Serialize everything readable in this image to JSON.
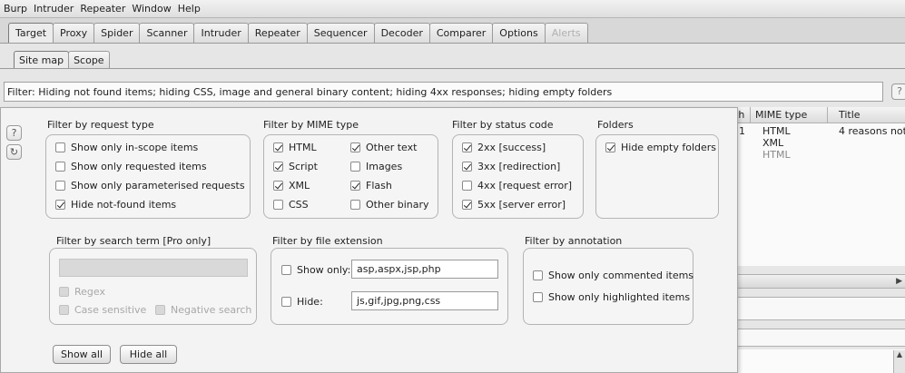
{
  "menubar": [
    "Burp",
    "Intruder",
    "Repeater",
    "Window",
    "Help"
  ],
  "main_tabs": [
    {
      "label": "Target",
      "active": true
    },
    {
      "label": "Proxy"
    },
    {
      "label": "Spider"
    },
    {
      "label": "Scanner"
    },
    {
      "label": "Intruder"
    },
    {
      "label": "Repeater"
    },
    {
      "label": "Sequencer"
    },
    {
      "label": "Decoder"
    },
    {
      "label": "Comparer"
    },
    {
      "label": "Options"
    },
    {
      "label": "Alerts",
      "disabled": true
    }
  ],
  "sub_tabs": [
    {
      "label": "Site map",
      "active": true
    },
    {
      "label": "Scope"
    }
  ],
  "filter_bar": {
    "text": "Filter: Hiding not found items;  hiding CSS, image and general binary content;  hiding 4xx responses;  hiding empty folders",
    "help_label": "?"
  },
  "popup": {
    "help_icon": "?",
    "refresh_icon": "↻",
    "request_type": {
      "title": "Filter by request type",
      "options": [
        {
          "label": "Show only in-scope items",
          "checked": false
        },
        {
          "label": "Show only requested items",
          "checked": false
        },
        {
          "label": "Show only parameterised requests",
          "checked": false
        },
        {
          "label": "Hide not-found items",
          "checked": true
        }
      ]
    },
    "mime_type": {
      "title": "Filter by MIME type",
      "options": [
        {
          "label": "HTML",
          "checked": true
        },
        {
          "label": "Other text",
          "checked": true
        },
        {
          "label": "Script",
          "checked": true
        },
        {
          "label": "Images",
          "checked": false
        },
        {
          "label": "XML",
          "checked": true
        },
        {
          "label": "Flash",
          "checked": true
        },
        {
          "label": "CSS",
          "checked": false
        },
        {
          "label": "Other binary",
          "checked": false
        }
      ]
    },
    "status_code": {
      "title": "Filter by status code",
      "options": [
        {
          "label": "2xx  [success]",
          "checked": true
        },
        {
          "label": "3xx  [redirection]",
          "checked": true
        },
        {
          "label": "4xx  [request error]",
          "checked": false
        },
        {
          "label": "5xx  [server error]",
          "checked": true
        }
      ]
    },
    "folders": {
      "title": "Folders",
      "options": [
        {
          "label": "Hide empty folders",
          "checked": true
        }
      ]
    },
    "search_term": {
      "title": "Filter by search term [Pro only]",
      "value": "",
      "options": [
        {
          "label": "Regex",
          "checked": false
        },
        {
          "label": "Case sensitive",
          "checked": false
        },
        {
          "label": "Negative search",
          "checked": false
        }
      ]
    },
    "file_extension": {
      "title": "Filter by file extension",
      "show_only": {
        "label": "Show only:",
        "checked": false,
        "value": "asp,aspx,jsp,php"
      },
      "hide": {
        "label": "Hide:",
        "checked": false,
        "value": "js,gif,jpg,png,css"
      }
    },
    "annotation": {
      "title": "Filter by annotation",
      "options": [
        {
          "label": "Show only commented items",
          "checked": false
        },
        {
          "label": "Show only highlighted items",
          "checked": false
        }
      ]
    },
    "buttons": {
      "show_all": "Show all",
      "hide_all": "Hide all"
    }
  },
  "right_table": {
    "headers": [
      "th",
      "MIME type",
      "Title"
    ],
    "rows": [
      {
        "len": "1",
        "mime": "HTML",
        "title": "4 reasons not"
      },
      {
        "len": "",
        "mime": "XML",
        "title": ""
      },
      {
        "len": "",
        "mime": "HTML",
        "title": ""
      }
    ],
    "scroll_arrow": "▶",
    "vscroll_arrow": "▲"
  }
}
